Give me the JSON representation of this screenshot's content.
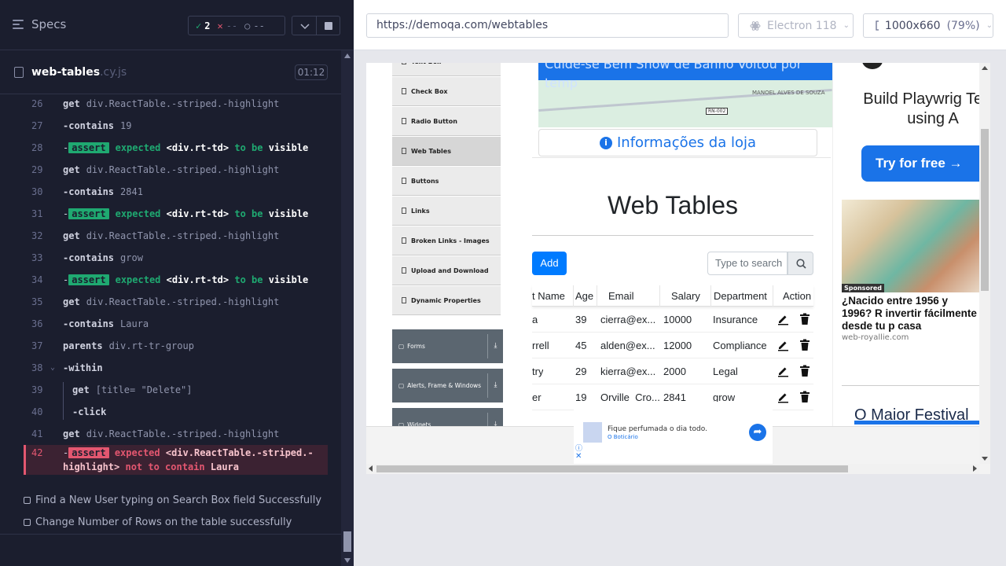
{
  "reporter": {
    "specs_label": "Specs",
    "stats": {
      "passed": "2",
      "failed": "--",
      "pending": "--"
    },
    "spec_file": {
      "name": "web-tables",
      "ext": ".cy.js",
      "duration": "01:12"
    },
    "commands": [
      {
        "n": "26",
        "kind": "cmd",
        "name": "get",
        "arg": "div.ReactTable.-striped.-highlight"
      },
      {
        "n": "27",
        "kind": "cmd",
        "name": "-contains",
        "arg": "19"
      },
      {
        "n": "28",
        "kind": "assert",
        "text_a": "expected",
        "el": "<div.rt-td>",
        "to_be": "to be",
        "state": "visible"
      },
      {
        "n": "29",
        "kind": "cmd",
        "name": "get",
        "arg": "div.ReactTable.-striped.-highlight"
      },
      {
        "n": "30",
        "kind": "cmd",
        "name": "-contains",
        "arg": "2841"
      },
      {
        "n": "31",
        "kind": "assert",
        "text_a": "expected",
        "el": "<div.rt-td>",
        "to_be": "to be",
        "state": "visible"
      },
      {
        "n": "32",
        "kind": "cmd",
        "name": "get",
        "arg": "div.ReactTable.-striped.-highlight"
      },
      {
        "n": "33",
        "kind": "cmd",
        "name": "-contains",
        "arg": "grow"
      },
      {
        "n": "34",
        "kind": "assert",
        "text_a": "expected",
        "el": "<div.rt-td>",
        "to_be": "to be",
        "state": "visible"
      },
      {
        "n": "35",
        "kind": "cmd",
        "name": "get",
        "arg": "div.ReactTable.-striped.-highlight"
      },
      {
        "n": "36",
        "kind": "cmd",
        "name": "-contains",
        "arg": "Laura"
      },
      {
        "n": "37",
        "kind": "cmd",
        "name": "parents",
        "arg": "div.rt-tr-group"
      },
      {
        "n": "38",
        "kind": "cmd",
        "name": "-within",
        "arg": "",
        "caret": true
      },
      {
        "n": "39",
        "kind": "nested",
        "name": "get",
        "arg": "[title= \"Delete\"]"
      },
      {
        "n": "40",
        "kind": "nested",
        "name": "-click",
        "arg": ""
      },
      {
        "n": "41",
        "kind": "cmd",
        "name": "get",
        "arg": "div.ReactTable.-striped.-highlight"
      }
    ],
    "assert_badge": "assert",
    "fail_cmd": {
      "n": "42",
      "expected": "expected",
      "el": "<div.ReactTable.-striped.-highlight>",
      "mid": "not to contain",
      "val": "Laura"
    },
    "pending_tests": [
      "Find a New User typing on Search Box field Successfully",
      "Change Number of Rows on the table successfully"
    ]
  },
  "aut": {
    "url": "https://demoqa.com/webtables",
    "browser": "Electron 118",
    "viewport": "1000x660",
    "zoom": "(79%)"
  },
  "site": {
    "nav_items": [
      "Text Box",
      "Check Box",
      "Radio Button",
      "Web Tables",
      "Buttons",
      "Links",
      "Broken Links - Images",
      "Upload and Download",
      "Dynamic Properties"
    ],
    "active_nav": "Web Tables",
    "groups": [
      "Forms",
      "Alerts, Frame & Windows",
      "Widgets"
    ],
    "ad_banner_text": "Cuide-se Bem Show de Banho Voltou por temp",
    "ad_place": "MANOEL ALVES DE SOUZA",
    "ad_road": "RN-002",
    "loja": "Informações da loja",
    "page_title": "Web Tables",
    "add_label": "Add",
    "search_placeholder": "Type to search",
    "columns": [
      "t Name",
      "Age",
      "Email",
      "Salary",
      "Department",
      "Action"
    ],
    "rows": [
      {
        "last": "a",
        "age": "39",
        "email": "cierra@ex...",
        "salary": "10000",
        "dept": "Insurance"
      },
      {
        "last": "rrell",
        "age": "45",
        "email": "alden@ex...",
        "salary": "12000",
        "dept": "Compliance"
      },
      {
        "last": "try",
        "age": "29",
        "email": "kierra@ex...",
        "salary": "2000",
        "dept": "Legal"
      },
      {
        "last": "er",
        "age": "19",
        "email": "Orville_Cro...",
        "salary": "2841",
        "dept": "grow"
      }
    ],
    "side_ad": {
      "headline": "Build Playwrig Tests using A",
      "cta": "Try for free →",
      "sponsored": "Sponsored",
      "nacido": "¿Nacido entre 1956 y 1996? R invertir fácilmente desde tu p casa",
      "domain": "web-royallie.com",
      "festival": "O Maior Festival"
    },
    "bottom_ad": {
      "line1": "Fique perfumada o dia todo.",
      "line2": "O Boticário"
    }
  },
  "colors": {
    "accent_green": "#1fa971",
    "fail_red": "#e45770",
    "reporter_bg": "#1b1e2e",
    "link_blue": "#007bff"
  }
}
